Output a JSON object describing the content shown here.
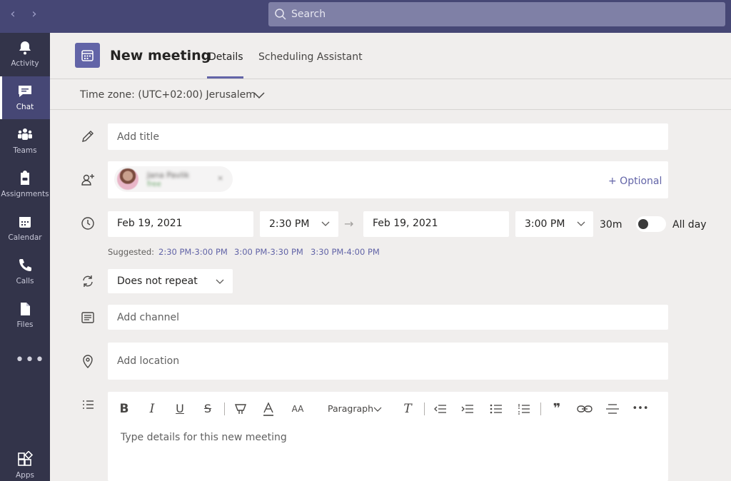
{
  "search": {
    "placeholder": "Search"
  },
  "rail": [
    {
      "label": "Activity",
      "icon": "bell-icon"
    },
    {
      "label": "Chat",
      "icon": "chat-icon",
      "active": true
    },
    {
      "label": "Teams",
      "icon": "teams-icon"
    },
    {
      "label": "Assignments",
      "icon": "assignments-icon"
    },
    {
      "label": "Calendar",
      "icon": "calendar-icon"
    },
    {
      "label": "Calls",
      "icon": "phone-icon"
    },
    {
      "label": "Files",
      "icon": "file-icon"
    }
  ],
  "rail_more": "•••",
  "rail_apps": {
    "label": "Apps",
    "icon": "apps-icon"
  },
  "header": {
    "title": "New meeting",
    "tabs": [
      {
        "label": "Details",
        "active": true
      },
      {
        "label": "Scheduling Assistant",
        "active": false
      }
    ]
  },
  "timezone": {
    "label": "Time zone: (UTC+02:00) Jerusalem"
  },
  "form": {
    "title_placeholder": "Add title",
    "attendee": {
      "name": "Jana Pavlik",
      "status": "free",
      "remove": "×"
    },
    "optional_label": "+ Optional",
    "start_date": "Feb 19, 2021",
    "start_time": "2:30 PM",
    "end_date": "Feb 19, 2021",
    "end_time": "3:00 PM",
    "duration": "30m",
    "all_day_label": "All day",
    "all_day_on": false,
    "suggested_label": "Suggested:",
    "suggested": [
      "2:30 PM-3:00 PM",
      "3:00 PM-3:30 PM",
      "3:30 PM-4:00 PM"
    ],
    "repeat": "Does not repeat",
    "channel_placeholder": "Add channel",
    "location_placeholder": "Add location"
  },
  "editor": {
    "bold": "B",
    "italic": "I",
    "underline": "U",
    "strikethrough": "S",
    "font_size": "AA",
    "paragraph": "Paragraph",
    "clear_format": "T",
    "quote": "❞",
    "more": "•••",
    "placeholder": "Type details for this new meeting"
  },
  "colors": {
    "accent": "#6264a7",
    "rail": "#33344a",
    "topbar": "#464775"
  }
}
